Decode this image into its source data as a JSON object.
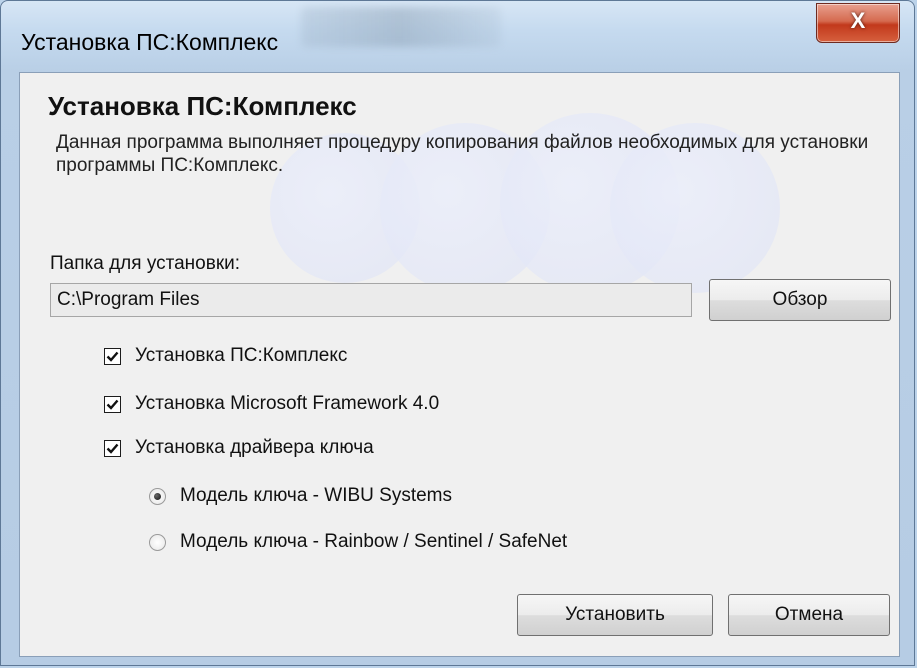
{
  "window": {
    "title": "Установка ПС:Комплекс",
    "close_glyph": "X"
  },
  "header": {
    "title": "Установка ПС:Комплекс",
    "description": "Данная программа выполняет процедуру копирования файлов необходимых для установки программы ПС:Комплекс."
  },
  "folder": {
    "label": "Папка для установки:",
    "value": "C:\\Program Files",
    "browse_label": "Обзор"
  },
  "options": {
    "install_complex": {
      "label": "Установка ПС:Комплекс",
      "checked": true
    },
    "install_framework": {
      "label": "Установка Microsoft Framework 4.0",
      "checked": true
    },
    "install_driver": {
      "label": "Установка драйвера ключа",
      "checked": true
    }
  },
  "key_model": {
    "wibu": {
      "label": "Модель ключа - WIBU Systems",
      "selected": true
    },
    "rainbow": {
      "label": "Модель ключа - Rainbow / Sentinel / SafeNet",
      "selected": false
    }
  },
  "actions": {
    "install_label": "Установить",
    "cancel_label": "Отмена"
  }
}
